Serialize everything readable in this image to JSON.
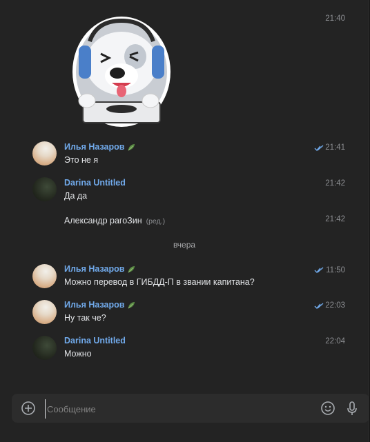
{
  "messages": [
    {
      "time": "21:40"
    },
    {
      "author": "Илья Назаров",
      "text": "Это не я",
      "time": "21:41"
    },
    {
      "author": "Darina Untitled",
      "text": "Да да",
      "time": "21:42"
    },
    {
      "text": "Александр рагоЗин",
      "edited": "(ред.)",
      "time": "21:42"
    },
    {
      "author": "Илья Назаров",
      "text": "Можно перевод в ГИБДД-П в звании капитана?",
      "time": "11:50"
    },
    {
      "author": "Илья Назаров",
      "text": "Ну так че?",
      "time": "22:03"
    },
    {
      "author": "Darina Untitled",
      "text": "Можно",
      "time": "22:04"
    }
  ],
  "date_separator": "вчера",
  "composer": {
    "placeholder": "Сообщение"
  },
  "colors": {
    "accent": "#71aaeb",
    "background": "#232323",
    "composer": "#2c2c2c"
  },
  "icons": [
    "add-attachment-icon",
    "emoji-icon",
    "microphone-icon",
    "read-ticks-icon",
    "leaf-icon"
  ]
}
